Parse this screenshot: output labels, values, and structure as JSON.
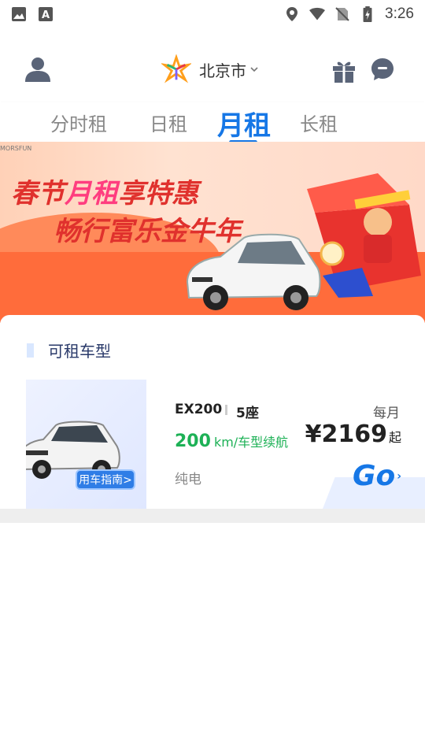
{
  "status_bar": {
    "time": "3:26",
    "icons": [
      "image-icon",
      "text-box-icon",
      "location-icon",
      "wifi-icon",
      "no-sim-icon",
      "battery-charging-icon"
    ]
  },
  "header": {
    "city": "北京市",
    "icons": [
      "avatar-icon",
      "city-logo",
      "chevron-down-icon",
      "gift-icon",
      "message-icon"
    ]
  },
  "tabs": [
    {
      "label": "分时租",
      "active": false
    },
    {
      "label": "日租",
      "active": false
    },
    {
      "label": "月租",
      "active": true
    },
    {
      "label": "长租",
      "active": false
    }
  ],
  "banner": {
    "brand_text": "MORSFUN",
    "line1_a": "春节",
    "line1_hl": "月租",
    "line1_b": "享特惠",
    "line2": "畅行富乐金牛年"
  },
  "section": {
    "title": "可租车型"
  },
  "car": {
    "model": "EX200",
    "seats": "5座",
    "range_value": "200",
    "range_unit": "km/车型续航",
    "fuel_type": "纯电",
    "price_label": "每月",
    "price": "¥2169",
    "price_suffix": "起",
    "guide_label": "用车指南>",
    "go_label": "Go",
    "go_arrow": "›"
  },
  "colors": {
    "accent": "#1677e6",
    "range_green": "#1db156",
    "banner_red": "#e0312d"
  }
}
